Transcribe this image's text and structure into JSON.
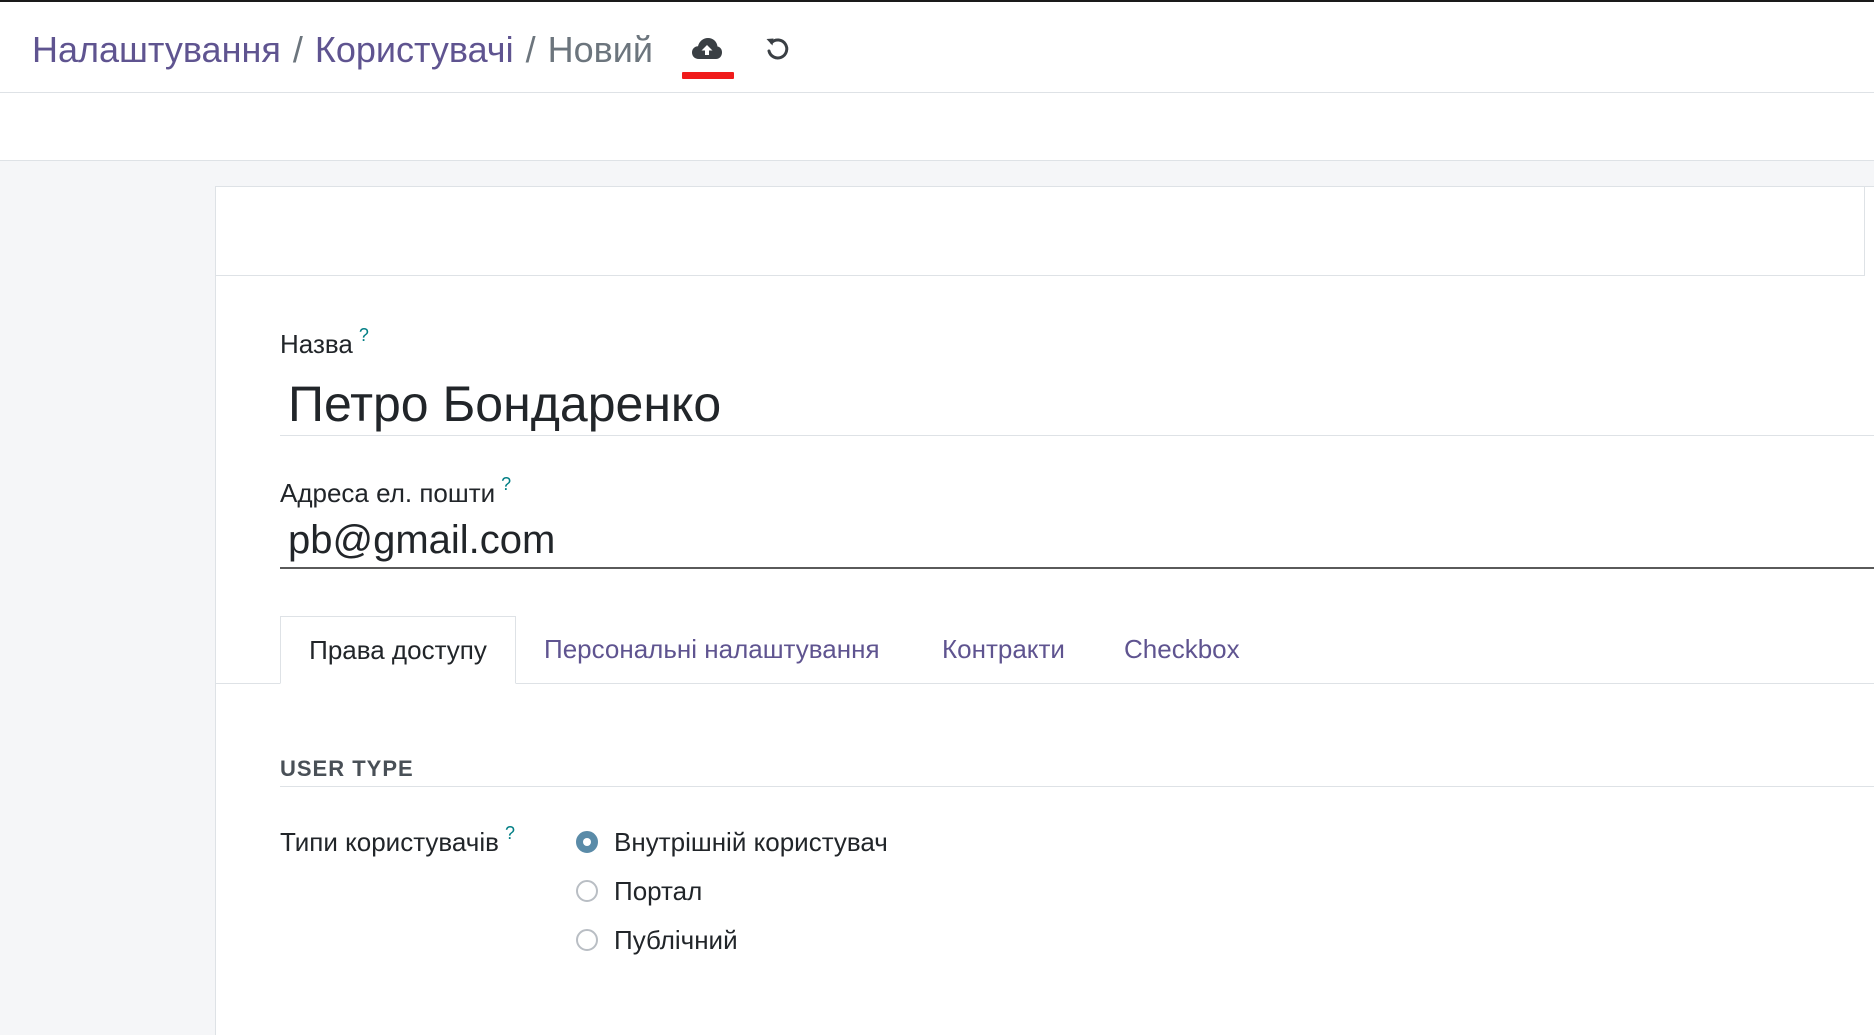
{
  "breadcrumb": {
    "items": [
      "Налаштування",
      "Користувачі"
    ],
    "separator": "/",
    "current": "Новий"
  },
  "toolbar": {
    "save_icon": "cloud-upload-icon",
    "discard_icon": "undo-icon"
  },
  "form": {
    "name": {
      "label": "Назва",
      "help": "?",
      "value": "Петро Бондаренко"
    },
    "email": {
      "label": "Адреса ел. пошти",
      "help": "?",
      "value": "pb@gmail.com"
    },
    "tabs": [
      {
        "label": "Права доступу",
        "active": true
      },
      {
        "label": "Персональні налаштування",
        "active": false
      },
      {
        "label": "Контракти",
        "active": false
      },
      {
        "label": "Checkbox",
        "active": false
      }
    ],
    "section_title": "USER TYPE",
    "user_types": {
      "label": "Типи користувачів",
      "help": "?",
      "options": [
        {
          "label": "Внутрішній користувач",
          "checked": true
        },
        {
          "label": "Портал",
          "checked": false
        },
        {
          "label": "Публічний",
          "checked": false
        }
      ]
    }
  },
  "colors": {
    "link": "#5f5490",
    "accent_radio": "#5a8ba8",
    "highlight_underline": "#f01b1b",
    "help": "#017e84"
  }
}
